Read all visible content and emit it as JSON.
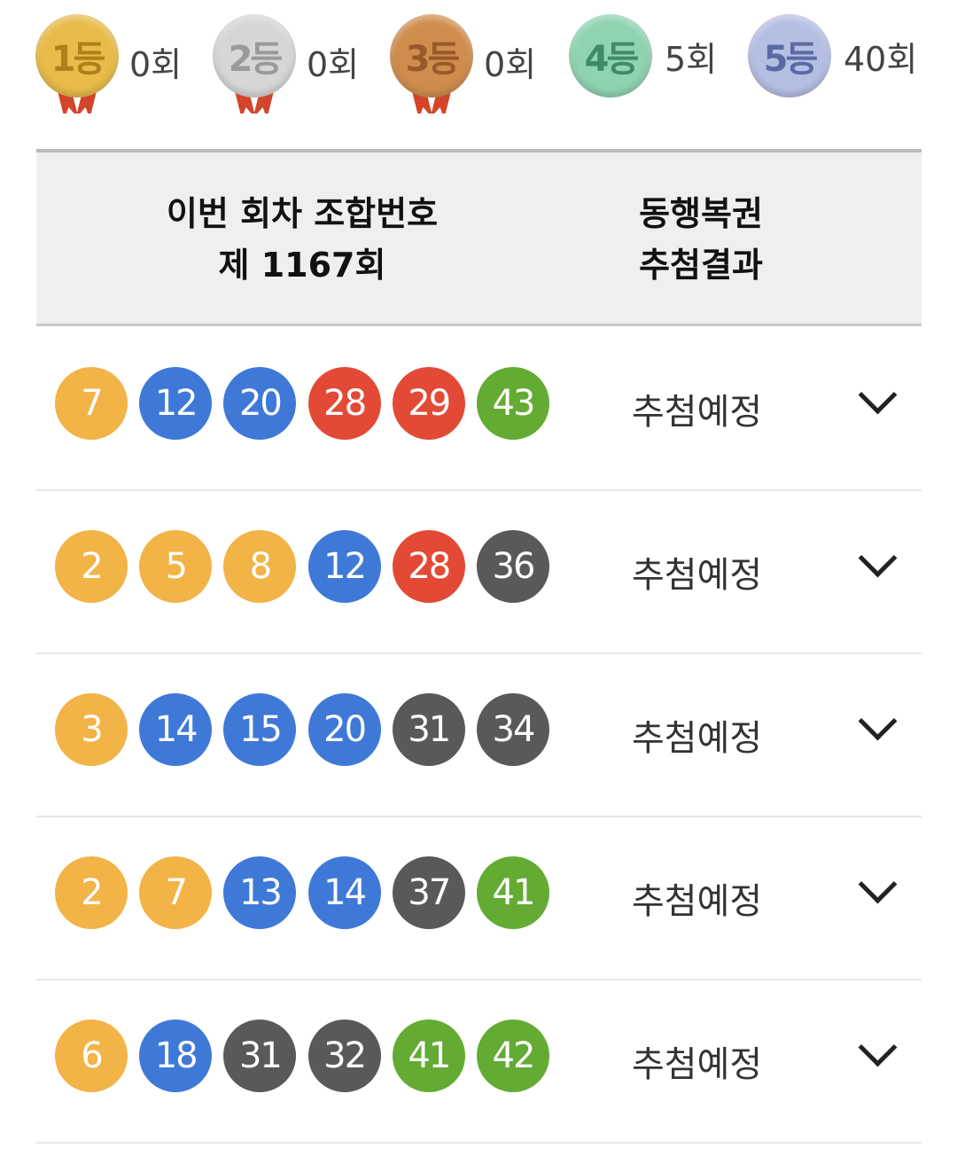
{
  "medals": [
    {
      "label": "1등",
      "count": "0회",
      "face": "#e8bb4a",
      "text": "#b0801a",
      "ribbon": "#d2452b"
    },
    {
      "label": "2등",
      "count": "0회",
      "face": "#d6d6d6",
      "text": "#9a9a9a",
      "ribbon": "#d2452b"
    },
    {
      "label": "3등",
      "count": "0회",
      "face": "#cf8d4d",
      "text": "#99592a",
      "ribbon": "#d2452b"
    },
    {
      "label": "4등",
      "count": "5회",
      "face": "#8fd3b0",
      "text": "#3f8a67"
    },
    {
      "label": "5등",
      "count": "40회",
      "face": "#b5bfe3",
      "text": "#5c6aa4"
    }
  ],
  "header": {
    "left_line1": "이번 회차 조합번호",
    "left_line2": "제 1167회",
    "right_line1": "동행복권",
    "right_line2": "추첨결과"
  },
  "ball_colors": {
    "yellow": "#f2b347",
    "blue": "#3f79d8",
    "red": "#e24a36",
    "gray": "#595959",
    "green": "#63ab33"
  },
  "rows": [
    {
      "numbers": [
        "7",
        "12",
        "20",
        "28",
        "29",
        "43"
      ],
      "status": "추첨예정"
    },
    {
      "numbers": [
        "2",
        "5",
        "8",
        "12",
        "28",
        "36"
      ],
      "status": "추첨예정"
    },
    {
      "numbers": [
        "3",
        "14",
        "15",
        "20",
        "31",
        "34"
      ],
      "status": "추첨예정"
    },
    {
      "numbers": [
        "2",
        "7",
        "13",
        "14",
        "37",
        "41"
      ],
      "status": "추첨예정"
    },
    {
      "numbers": [
        "6",
        "18",
        "31",
        "32",
        "41",
        "42"
      ],
      "status": "추첨예정"
    }
  ]
}
